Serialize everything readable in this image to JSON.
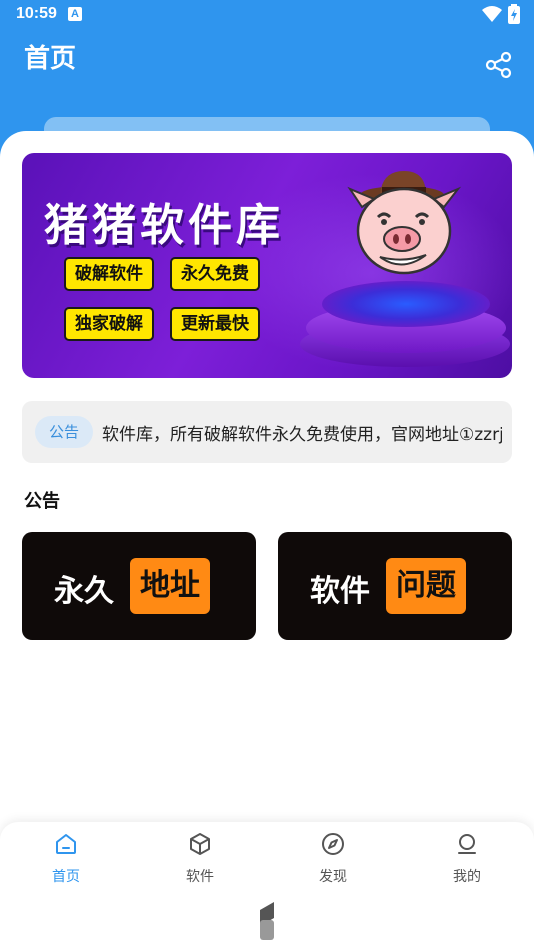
{
  "status_bar": {
    "time": "10:59",
    "notification_icon": "A"
  },
  "header": {
    "title": "首页",
    "share_icon": "share-icon"
  },
  "banner": {
    "title": "猪猪软件库",
    "tags": [
      "破解软件",
      "永久免费",
      "独家破解",
      "更新最快"
    ]
  },
  "notice": {
    "badge": "公告",
    "text": "软件库，所有破解软件永久免费使用，官网地址①zzrj"
  },
  "section": {
    "title": "公告"
  },
  "cards": [
    {
      "white": "永久",
      "orange": "地址"
    },
    {
      "white": "软件",
      "orange": "问题"
    }
  ],
  "nav": {
    "items": [
      {
        "label": "首页",
        "icon": "home-icon",
        "active": true
      },
      {
        "label": "软件",
        "icon": "cube-icon"
      },
      {
        "label": "发现",
        "icon": "compass-icon"
      },
      {
        "label": "我的",
        "icon": "user-icon"
      }
    ]
  },
  "colors": {
    "primary": "#2f95ee",
    "banner": "#7d1fd8",
    "tag": "#ffe600",
    "card_orange": "#ff8a14"
  }
}
